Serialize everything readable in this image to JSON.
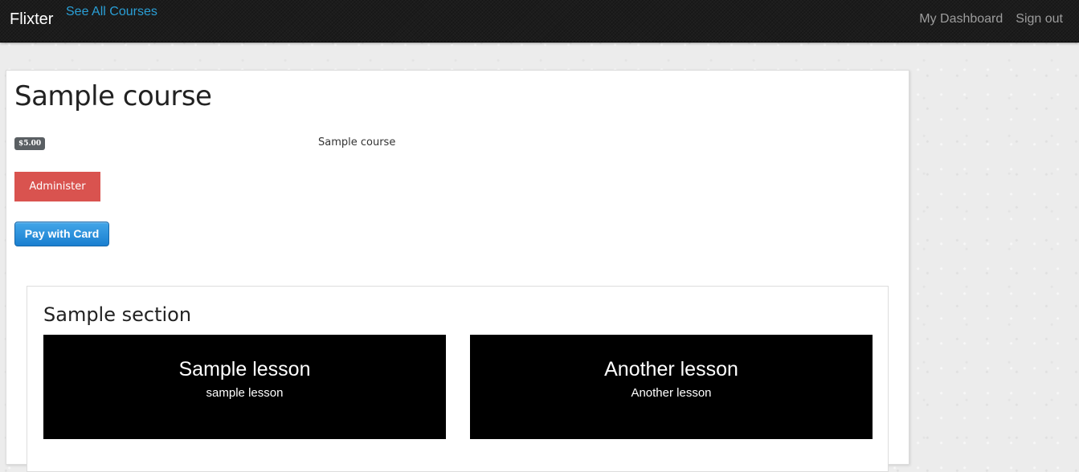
{
  "navbar": {
    "brand": "Flixter",
    "courses_link": "See All Courses",
    "dashboard_link": "My Dashboard",
    "signout_link": "Sign out"
  },
  "course": {
    "title": "Sample course",
    "price": "$5.00",
    "description": "Sample course",
    "administer_label": "Administer",
    "pay_label": "Pay with Card"
  },
  "section": {
    "title": "Sample section",
    "lessons": [
      {
        "title": "Sample lesson",
        "subtitle": "sample lesson"
      },
      {
        "title": "Another lesson",
        "subtitle": "Another lesson"
      }
    ]
  },
  "colors": {
    "navbar_bg": "#1c1c1c",
    "link_blue": "#2a9fd6",
    "nav_muted": "#9d9d9d",
    "danger": "#d9534f",
    "badge": "#5a5f63",
    "lesson_bg": "#000000"
  }
}
